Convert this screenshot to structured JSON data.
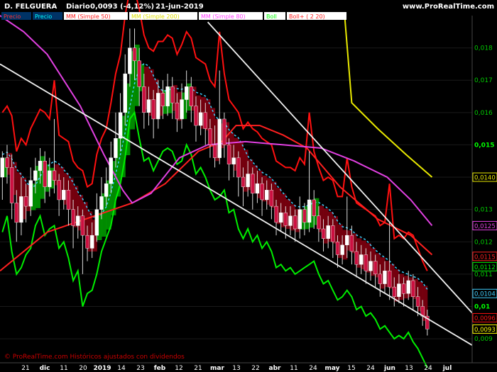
{
  "header": {
    "instrument": "D. FELGUERA",
    "period": "Diario",
    "last": "0,0093 (-4,12%)",
    "date": "21-jun-2019",
    "brand": "www.ProRealTime.com"
  },
  "legend": [
    {
      "label": "Precio",
      "color": "#ff3030",
      "bg": "#003366"
    },
    {
      "label": "Precio",
      "color": "#00ffff",
      "bg": "#003366"
    },
    {
      "label": "MM (Simple 50)",
      "color": "#ff2020",
      "bg": "#ffffff"
    },
    {
      "label": "MM (Simple 200)",
      "color": "#e0e000",
      "bg": "#ffffff"
    },
    {
      "label": "MM (Simple 80)",
      "color": "#ff40ff",
      "bg": "#ffffff"
    },
    {
      "label": "Boll",
      "color": "#00ff00",
      "bg": "#ffffff"
    },
    {
      "label": "Boll+ ( 2 20)",
      "color": "#ff2020",
      "bg": "#ffffff"
    }
  ],
  "footer_note": "© ProRealTime.com  Históricos ajustados con dividendos",
  "colors": {
    "background": "#000000",
    "grid": "#1a1a1a",
    "candle_up": "#ffffff",
    "candle_down": "#cc1040",
    "cloud_bull": "#009900",
    "cloud_bear": "#800010",
    "mm50": "#ff2020",
    "mm200": "#e8e800",
    "mm80": "#e040e0",
    "boll_green": "#00ee00",
    "boll_red": "#ff1010",
    "trendline": "#f0f0f0",
    "cyan": "#40d0ff"
  },
  "chart_data": {
    "type": "candlestick",
    "ylim": [
      0.0083,
      0.019
    ],
    "y_ticks": [
      "0,018",
      "0,017",
      "0,016",
      "0,015",
      "0,014",
      "0,013",
      "0,012",
      "0,011",
      "0,01",
      "0,009"
    ],
    "y_tick_values": [
      0.018,
      0.017,
      0.016,
      0.015,
      0.014,
      0.013,
      0.012,
      0.011,
      0.01,
      0.009
    ],
    "y_tick_bold": [
      false,
      false,
      false,
      true,
      false,
      false,
      false,
      false,
      true,
      false
    ],
    "x_labels": [
      "21",
      "dic",
      "11",
      "20",
      "2019",
      "14",
      "23",
      "feb",
      "12",
      "21",
      "mar",
      "13",
      "22",
      "abr",
      "11",
      "24",
      "may",
      "15",
      "24",
      "jun",
      "13",
      "24",
      "jul"
    ],
    "x_label_bold": [
      false,
      true,
      false,
      false,
      true,
      false,
      false,
      true,
      false,
      false,
      true,
      false,
      false,
      true,
      false,
      false,
      true,
      false,
      false,
      true,
      false,
      false,
      true
    ],
    "value_tags": [
      {
        "value": "0,0140",
        "y": 0.014,
        "color": "#e8e800"
      },
      {
        "value": "0,0125",
        "y": 0.0125,
        "color": "#e040e0"
      },
      {
        "value": "0,0115",
        "y": 0.01155,
        "color": "#ff2020"
      },
      {
        "value": "0,0112",
        "y": 0.01123,
        "color": "#00ee00"
      },
      {
        "value": "0,0104",
        "y": 0.0104,
        "color": "#40d0ff"
      },
      {
        "value": "0,0096",
        "y": 0.00965,
        "color": "#ff1010"
      },
      {
        "value": "0,0093",
        "y": 0.0093,
        "color": "#ffff00"
      }
    ],
    "series": [
      {
        "name": "MM (Simple 200)",
        "points": [
          [
            0.73,
            0.019
          ],
          [
            0.745,
            0.0163
          ],
          [
            0.8,
            0.0155
          ],
          [
            0.86,
            0.0147
          ],
          [
            0.915,
            0.014
          ]
        ]
      },
      {
        "name": "MM (Simple 50)",
        "points": [
          [
            0.0,
            0.0111
          ],
          [
            0.1,
            0.0123
          ],
          [
            0.2,
            0.0128
          ],
          [
            0.28,
            0.0132
          ],
          [
            0.35,
            0.0138
          ],
          [
            0.42,
            0.0148
          ],
          [
            0.47,
            0.0151
          ],
          [
            0.5,
            0.0156
          ],
          [
            0.55,
            0.0156
          ],
          [
            0.6,
            0.0153
          ],
          [
            0.65,
            0.0149
          ],
          [
            0.72,
            0.0137
          ],
          [
            0.8,
            0.0127
          ],
          [
            0.87,
            0.0122
          ],
          [
            0.915,
            0.0116
          ]
        ]
      },
      {
        "name": "MM (Simple 80)",
        "points": [
          [
            0.0,
            0.019
          ],
          [
            0.05,
            0.0185
          ],
          [
            0.1,
            0.0178
          ],
          [
            0.17,
            0.0162
          ],
          [
            0.22,
            0.0147
          ],
          [
            0.26,
            0.0136
          ],
          [
            0.28,
            0.0132
          ],
          [
            0.32,
            0.0135
          ],
          [
            0.38,
            0.0146
          ],
          [
            0.44,
            0.015
          ],
          [
            0.52,
            0.0151
          ],
          [
            0.6,
            0.015
          ],
          [
            0.68,
            0.0149
          ],
          [
            0.75,
            0.0145
          ],
          [
            0.82,
            0.014
          ],
          [
            0.87,
            0.0133
          ],
          [
            0.915,
            0.0125
          ]
        ]
      }
    ],
    "candles": [
      {
        "x": 0.005,
        "o": 0.014,
        "c": 0.0146,
        "h": 0.0148,
        "l": 0.0133
      },
      {
        "x": 0.015,
        "o": 0.0146,
        "c": 0.0143,
        "h": 0.015,
        "l": 0.0138
      },
      {
        "x": 0.025,
        "o": 0.0143,
        "c": 0.0132,
        "h": 0.0147,
        "l": 0.0127
      },
      {
        "x": 0.035,
        "o": 0.0132,
        "c": 0.0126,
        "h": 0.0136,
        "l": 0.012
      },
      {
        "x": 0.045,
        "o": 0.0126,
        "c": 0.0134,
        "h": 0.014,
        "l": 0.0122
      },
      {
        "x": 0.055,
        "o": 0.0134,
        "c": 0.0131,
        "h": 0.0138,
        "l": 0.0126
      },
      {
        "x": 0.065,
        "o": 0.0131,
        "c": 0.0139,
        "h": 0.0143,
        "l": 0.0128
      },
      {
        "x": 0.075,
        "o": 0.0139,
        "c": 0.0142,
        "h": 0.0146,
        "l": 0.0135
      },
      {
        "x": 0.085,
        "o": 0.0142,
        "c": 0.0145,
        "h": 0.0149,
        "l": 0.0138
      },
      {
        "x": 0.095,
        "o": 0.0145,
        "c": 0.0137,
        "h": 0.0148,
        "l": 0.0132
      },
      {
        "x": 0.105,
        "o": 0.0137,
        "c": 0.0142,
        "h": 0.0146,
        "l": 0.0134
      },
      {
        "x": 0.115,
        "o": 0.0142,
        "c": 0.0139,
        "h": 0.0158,
        "l": 0.0135
      },
      {
        "x": 0.125,
        "o": 0.0139,
        "c": 0.0133,
        "h": 0.0141,
        "l": 0.0128
      },
      {
        "x": 0.135,
        "o": 0.0133,
        "c": 0.0136,
        "h": 0.014,
        "l": 0.013
      },
      {
        "x": 0.145,
        "o": 0.0136,
        "c": 0.013,
        "h": 0.0139,
        "l": 0.0125
      },
      {
        "x": 0.155,
        "o": 0.013,
        "c": 0.0125,
        "h": 0.0133,
        "l": 0.0118
      },
      {
        "x": 0.165,
        "o": 0.0125,
        "c": 0.0128,
        "h": 0.0131,
        "l": 0.0121
      },
      {
        "x": 0.175,
        "o": 0.0128,
        "c": 0.0122,
        "h": 0.013,
        "l": 0.011
      },
      {
        "x": 0.185,
        "o": 0.0122,
        "c": 0.0118,
        "h": 0.0125,
        "l": 0.0114
      },
      {
        "x": 0.195,
        "o": 0.0118,
        "c": 0.0122,
        "h": 0.0126,
        "l": 0.0115
      },
      {
        "x": 0.205,
        "o": 0.0122,
        "c": 0.013,
        "h": 0.0135,
        "l": 0.012
      },
      {
        "x": 0.215,
        "o": 0.013,
        "c": 0.0134,
        "h": 0.014,
        "l": 0.0127
      },
      {
        "x": 0.225,
        "o": 0.0134,
        "c": 0.0138,
        "h": 0.0143,
        "l": 0.0131
      },
      {
        "x": 0.235,
        "o": 0.0138,
        "c": 0.0146,
        "h": 0.0151,
        "l": 0.0135
      },
      {
        "x": 0.245,
        "o": 0.0146,
        "c": 0.0152,
        "h": 0.016,
        "l": 0.0143
      },
      {
        "x": 0.255,
        "o": 0.0152,
        "c": 0.016,
        "h": 0.0166,
        "l": 0.0148
      },
      {
        "x": 0.265,
        "o": 0.016,
        "c": 0.0172,
        "h": 0.0178,
        "l": 0.0156
      },
      {
        "x": 0.275,
        "o": 0.0172,
        "c": 0.018,
        "h": 0.0186,
        "l": 0.0168
      },
      {
        "x": 0.285,
        "o": 0.018,
        "c": 0.0176,
        "h": 0.0186,
        "l": 0.017
      },
      {
        "x": 0.295,
        "o": 0.0176,
        "c": 0.0168,
        "h": 0.018,
        "l": 0.0162
      },
      {
        "x": 0.305,
        "o": 0.0168,
        "c": 0.016,
        "h": 0.0172,
        "l": 0.0155
      },
      {
        "x": 0.315,
        "o": 0.016,
        "c": 0.0164,
        "h": 0.0168,
        "l": 0.0156
      },
      {
        "x": 0.325,
        "o": 0.0164,
        "c": 0.0158,
        "h": 0.0167,
        "l": 0.0152
      },
      {
        "x": 0.335,
        "o": 0.0158,
        "c": 0.0166,
        "h": 0.017,
        "l": 0.0155
      },
      {
        "x": 0.345,
        "o": 0.0166,
        "c": 0.0162,
        "h": 0.017,
        "l": 0.0158
      },
      {
        "x": 0.355,
        "o": 0.0162,
        "c": 0.0168,
        "h": 0.0172,
        "l": 0.0159
      },
      {
        "x": 0.365,
        "o": 0.0168,
        "c": 0.0163,
        "h": 0.0171,
        "l": 0.0158
      },
      {
        "x": 0.375,
        "o": 0.0163,
        "c": 0.0158,
        "h": 0.0166,
        "l": 0.0154
      },
      {
        "x": 0.385,
        "o": 0.0158,
        "c": 0.0164,
        "h": 0.0169,
        "l": 0.0155
      },
      {
        "x": 0.395,
        "o": 0.0164,
        "c": 0.0168,
        "h": 0.0173,
        "l": 0.016
      },
      {
        "x": 0.405,
        "o": 0.0168,
        "c": 0.0162,
        "h": 0.0171,
        "l": 0.0157
      },
      {
        "x": 0.415,
        "o": 0.0162,
        "c": 0.0156,
        "h": 0.0165,
        "l": 0.0151
      },
      {
        "x": 0.425,
        "o": 0.0156,
        "c": 0.016,
        "h": 0.0164,
        "l": 0.0153
      },
      {
        "x": 0.435,
        "o": 0.016,
        "c": 0.0155,
        "h": 0.0163,
        "l": 0.015
      },
      {
        "x": 0.445,
        "o": 0.0155,
        "c": 0.015,
        "h": 0.0158,
        "l": 0.0146
      },
      {
        "x": 0.455,
        "o": 0.015,
        "c": 0.0146,
        "h": 0.0156,
        "l": 0.0143
      },
      {
        "x": 0.465,
        "o": 0.0146,
        "c": 0.0158,
        "h": 0.0173,
        "l": 0.0144
      },
      {
        "x": 0.475,
        "o": 0.0158,
        "c": 0.015,
        "h": 0.016,
        "l": 0.0146
      },
      {
        "x": 0.485,
        "o": 0.015,
        "c": 0.0144,
        "h": 0.0152,
        "l": 0.0139
      },
      {
        "x": 0.495,
        "o": 0.0144,
        "c": 0.0146,
        "h": 0.015,
        "l": 0.014
      },
      {
        "x": 0.505,
        "o": 0.0146,
        "c": 0.014,
        "h": 0.0148,
        "l": 0.0134
      },
      {
        "x": 0.515,
        "o": 0.014,
        "c": 0.0137,
        "h": 0.0143,
        "l": 0.0131
      },
      {
        "x": 0.525,
        "o": 0.0137,
        "c": 0.0141,
        "h": 0.0145,
        "l": 0.0134
      },
      {
        "x": 0.535,
        "o": 0.0141,
        "c": 0.0135,
        "h": 0.0143,
        "l": 0.013
      },
      {
        "x": 0.545,
        "o": 0.0135,
        "c": 0.0138,
        "h": 0.0142,
        "l": 0.0132
      },
      {
        "x": 0.555,
        "o": 0.0138,
        "c": 0.0133,
        "h": 0.014,
        "l": 0.0128
      },
      {
        "x": 0.565,
        "o": 0.0133,
        "c": 0.0136,
        "h": 0.0139,
        "l": 0.013
      },
      {
        "x": 0.575,
        "o": 0.0136,
        "c": 0.0131,
        "h": 0.0138,
        "l": 0.0127
      },
      {
        "x": 0.585,
        "o": 0.0131,
        "c": 0.0126,
        "h": 0.0133,
        "l": 0.0122
      },
      {
        "x": 0.595,
        "o": 0.0126,
        "c": 0.0129,
        "h": 0.0132,
        "l": 0.0123
      },
      {
        "x": 0.605,
        "o": 0.0129,
        "c": 0.0125,
        "h": 0.0131,
        "l": 0.0121
      },
      {
        "x": 0.615,
        "o": 0.0125,
        "c": 0.0128,
        "h": 0.0131,
        "l": 0.0122
      },
      {
        "x": 0.625,
        "o": 0.0128,
        "c": 0.0124,
        "h": 0.013,
        "l": 0.012
      },
      {
        "x": 0.635,
        "o": 0.0124,
        "c": 0.013,
        "h": 0.0134,
        "l": 0.0121
      },
      {
        "x": 0.645,
        "o": 0.013,
        "c": 0.0126,
        "h": 0.0132,
        "l": 0.0122
      },
      {
        "x": 0.655,
        "o": 0.0126,
        "c": 0.0133,
        "h": 0.0148,
        "l": 0.0123
      },
      {
        "x": 0.665,
        "o": 0.0133,
        "c": 0.0128,
        "h": 0.0136,
        "l": 0.0124
      },
      {
        "x": 0.675,
        "o": 0.0128,
        "c": 0.0124,
        "h": 0.0131,
        "l": 0.012
      },
      {
        "x": 0.685,
        "o": 0.0124,
        "c": 0.0121,
        "h": 0.0127,
        "l": 0.0117
      },
      {
        "x": 0.695,
        "o": 0.0121,
        "c": 0.0125,
        "h": 0.0128,
        "l": 0.0118
      },
      {
        "x": 0.705,
        "o": 0.0125,
        "c": 0.012,
        "h": 0.0127,
        "l": 0.0115
      },
      {
        "x": 0.715,
        "o": 0.012,
        "c": 0.0116,
        "h": 0.0122,
        "l": 0.0112
      },
      {
        "x": 0.725,
        "o": 0.0116,
        "c": 0.0119,
        "h": 0.0122,
        "l": 0.0113
      },
      {
        "x": 0.735,
        "o": 0.0119,
        "c": 0.0122,
        "h": 0.0134,
        "l": 0.0115
      },
      {
        "x": 0.745,
        "o": 0.0122,
        "c": 0.0117,
        "h": 0.0125,
        "l": 0.0113
      },
      {
        "x": 0.755,
        "o": 0.0117,
        "c": 0.0113,
        "h": 0.012,
        "l": 0.0109
      },
      {
        "x": 0.765,
        "o": 0.0113,
        "c": 0.0116,
        "h": 0.0119,
        "l": 0.011
      },
      {
        "x": 0.775,
        "o": 0.0116,
        "c": 0.0111,
        "h": 0.0118,
        "l": 0.0107
      },
      {
        "x": 0.785,
        "o": 0.0111,
        "c": 0.0114,
        "h": 0.0117,
        "l": 0.0108
      },
      {
        "x": 0.795,
        "o": 0.0114,
        "c": 0.011,
        "h": 0.0116,
        "l": 0.0106
      },
      {
        "x": 0.805,
        "o": 0.011,
        "c": 0.0107,
        "h": 0.0113,
        "l": 0.0103
      },
      {
        "x": 0.815,
        "o": 0.0107,
        "c": 0.0111,
        "h": 0.0114,
        "l": 0.0104
      },
      {
        "x": 0.825,
        "o": 0.0111,
        "c": 0.0106,
        "h": 0.0126,
        "l": 0.0102
      },
      {
        "x": 0.835,
        "o": 0.0106,
        "c": 0.0103,
        "h": 0.0109,
        "l": 0.01
      },
      {
        "x": 0.845,
        "o": 0.0103,
        "c": 0.0107,
        "h": 0.011,
        "l": 0.0101
      },
      {
        "x": 0.855,
        "o": 0.0107,
        "c": 0.0104,
        "h": 0.0109,
        "l": 0.01
      },
      {
        "x": 0.865,
        "o": 0.0104,
        "c": 0.0108,
        "h": 0.0111,
        "l": 0.0102
      },
      {
        "x": 0.875,
        "o": 0.0108,
        "c": 0.0103,
        "h": 0.011,
        "l": 0.0099
      },
      {
        "x": 0.885,
        "o": 0.0103,
        "c": 0.01,
        "h": 0.0106,
        "l": 0.0097
      },
      {
        "x": 0.895,
        "o": 0.01,
        "c": 0.0097,
        "h": 0.0102,
        "l": 0.0094
      },
      {
        "x": 0.905,
        "o": 0.0097,
        "c": 0.0093,
        "h": 0.0099,
        "l": 0.0091
      }
    ],
    "trendlines": [
      {
        "from": [
          0.0,
          0.0175
        ],
        "to": [
          1.0,
          0.0088
        ]
      },
      {
        "from": [
          0.44,
          0.0188
        ],
        "to": [
          1.0,
          0.0098
        ]
      }
    ]
  }
}
